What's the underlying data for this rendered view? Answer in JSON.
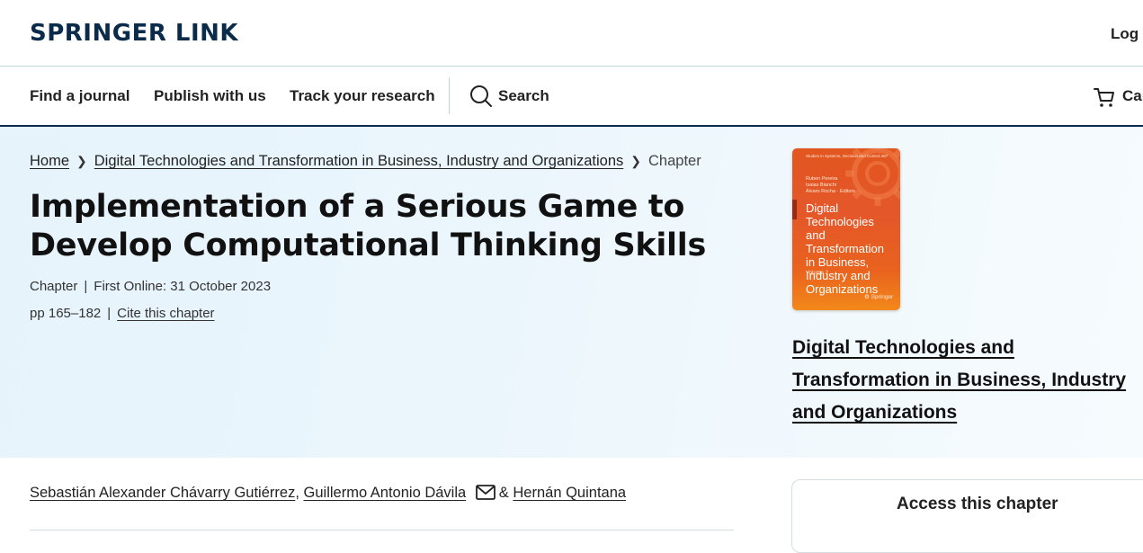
{
  "header": {
    "logo": "SPRINGER LINK",
    "login_label": "Log i"
  },
  "nav": {
    "items": [
      "Find a journal",
      "Publish with us",
      "Track your research"
    ],
    "search_label": "Search",
    "cart_label": "Car"
  },
  "breadcrumb": {
    "home": "Home",
    "book": "Digital Technologies and Transformation in Business, Industry and Organizations",
    "current": "Chapter"
  },
  "chapter": {
    "title": "Implementation of a Serious Game to Develop Computational Thinking Skills",
    "type": "Chapter",
    "first_online": "First Online: 31 October 2023",
    "pages": "pp 165–182",
    "cite_label": "Cite this chapter"
  },
  "book": {
    "title": "Digital Technologies and Transformation in Business, Industry and Organizations",
    "cover": {
      "series": "Studies in Systems, Decision and Control 487",
      "editors": [
        "Ruben Pereira",
        "Isaias Bianchi",
        "Álvaro Rocha",
        "Editors"
      ],
      "title": "Digital Technologies and Transformation in Business, Industry and Organizations",
      "volume": "Volume 2",
      "publisher": "Springer"
    }
  },
  "authors": {
    "list": [
      "Sebastián Alexander Chávarry Gutiérrez",
      "Guillermo Antonio Dávila",
      "Hernán Quintana"
    ],
    "separator_comma": ",",
    "separator_and": "&"
  },
  "access": {
    "heading": "Access this chapter"
  },
  "colors": {
    "brand": "#0b2b4a",
    "hero_bg": "#e9f5fb",
    "cover_orange": "#e4572a"
  }
}
